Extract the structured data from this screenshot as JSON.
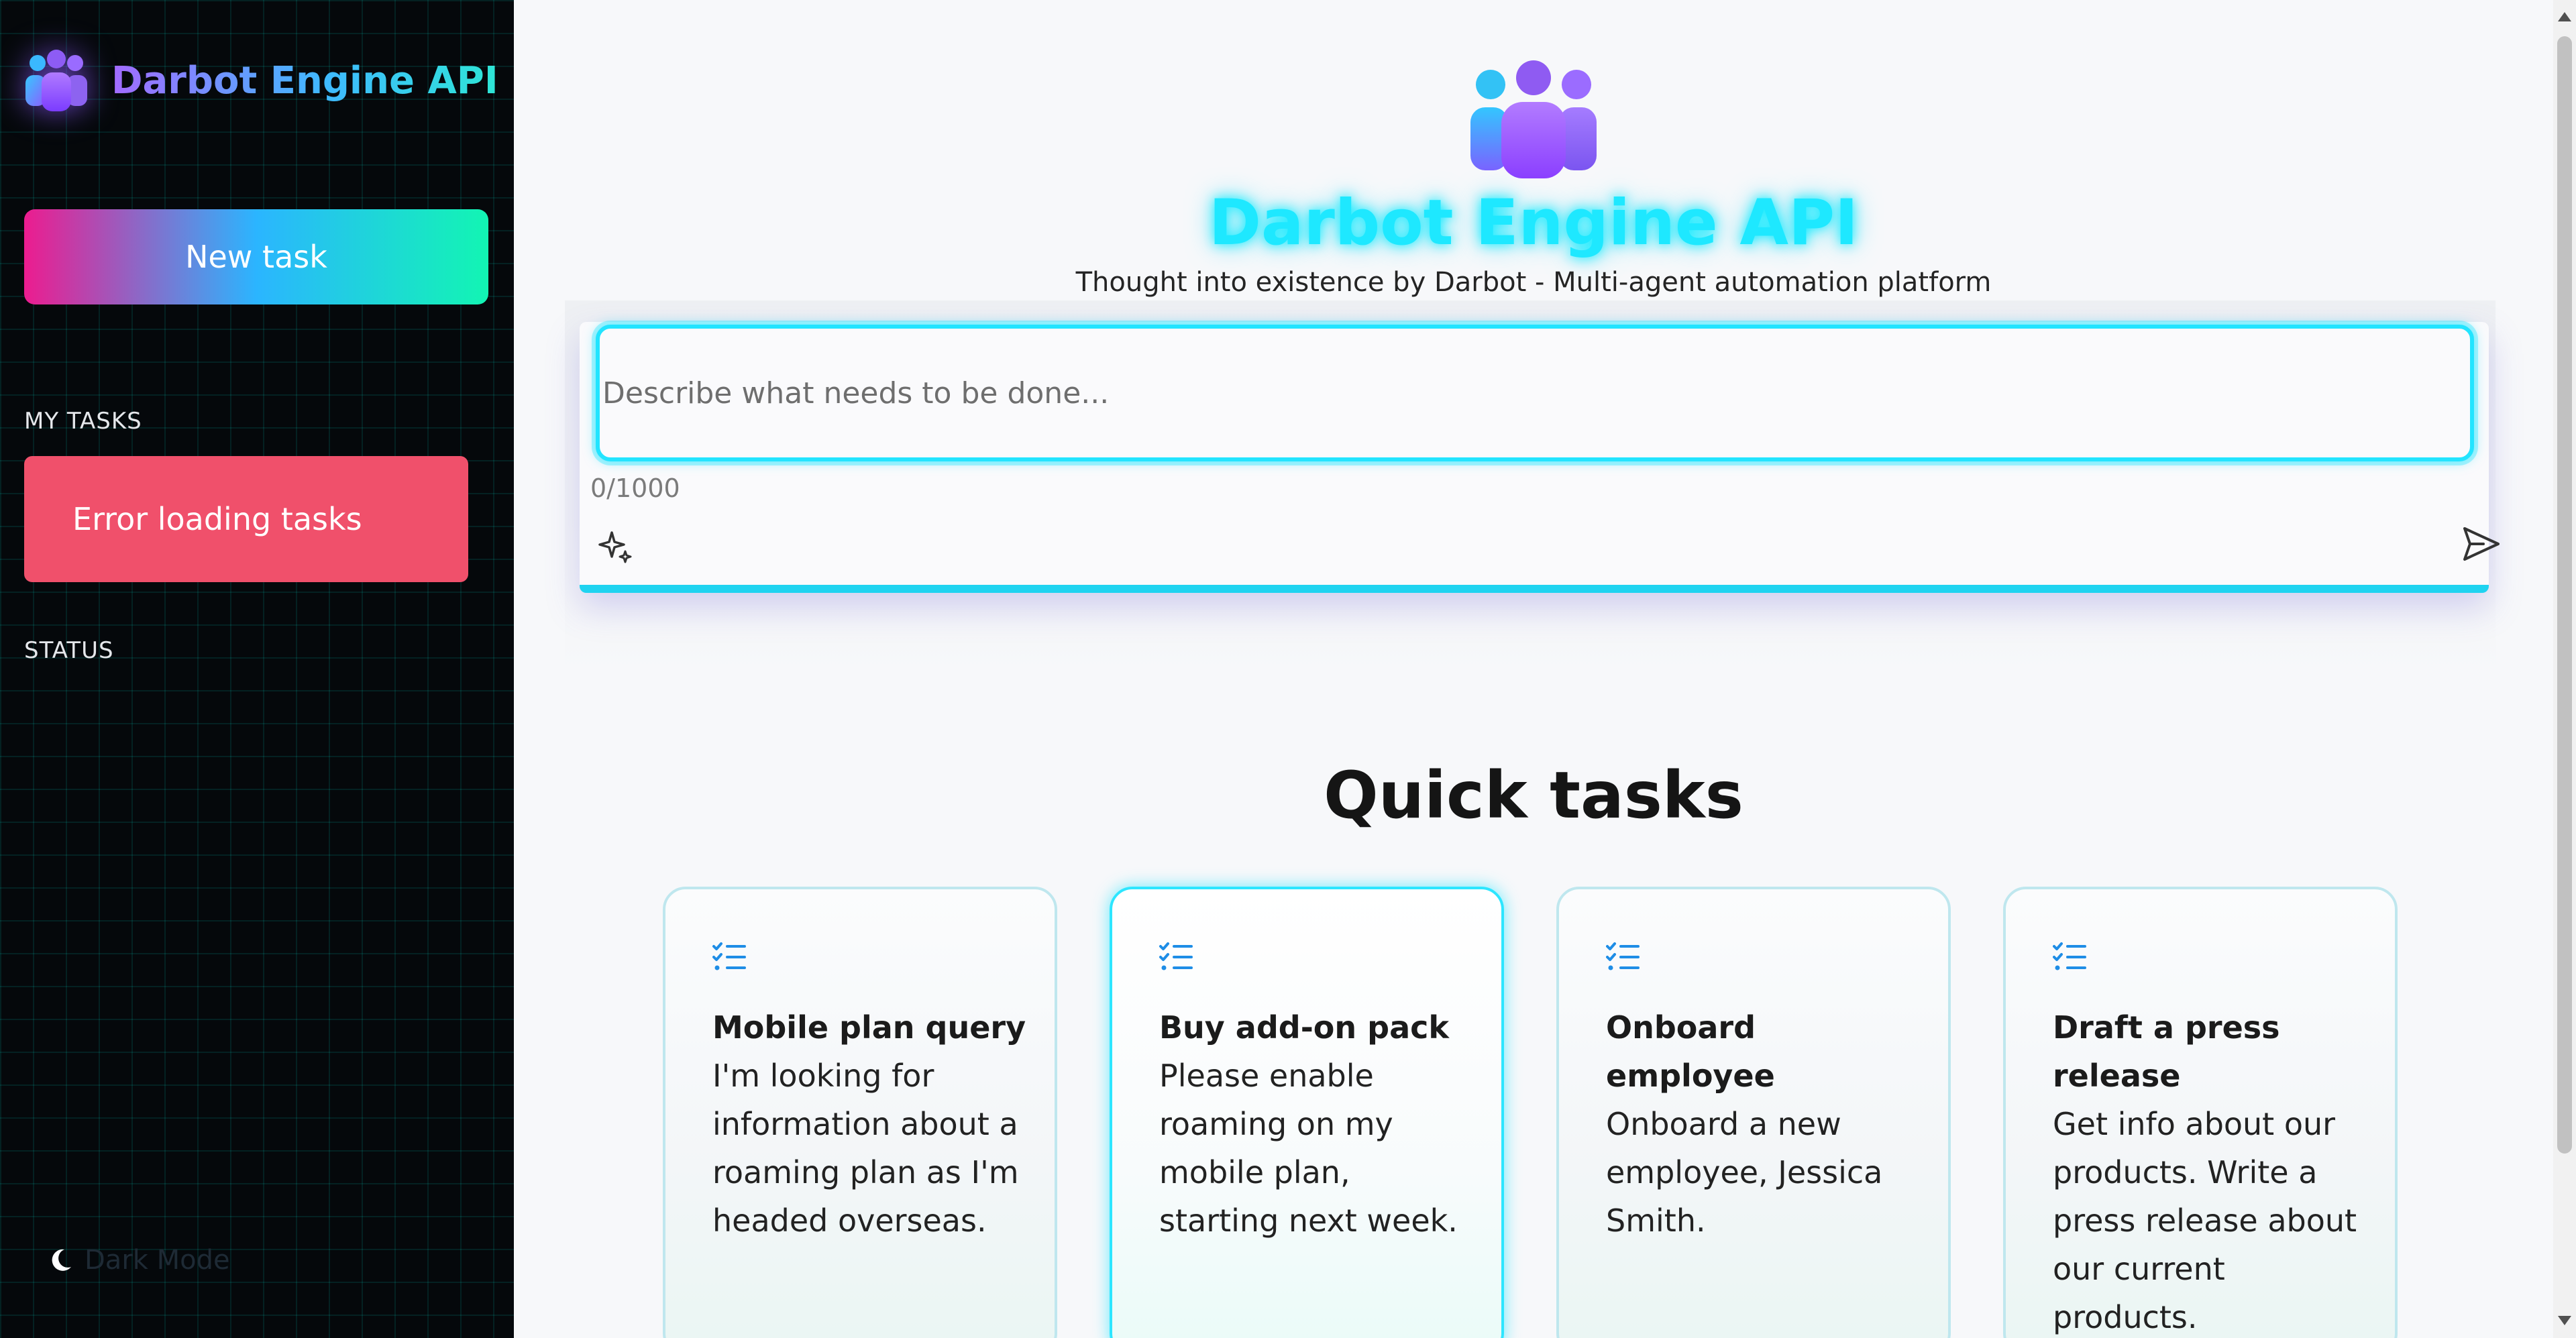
{
  "sidebar": {
    "brand_title": "Darbot Engine API",
    "new_task_label": "New task",
    "my_tasks_label": "MY TASKS",
    "error_message": "Error loading tasks",
    "status_label": "STATUS",
    "dark_mode_label": "Dark Mode"
  },
  "hero": {
    "title": "Darbot Engine API",
    "subtitle": "Thought into existence by Darbot - Multi-agent automation platform"
  },
  "composer": {
    "placeholder": "Describe what needs to be done...",
    "char_count": "0/1000"
  },
  "quick_tasks": {
    "heading": "Quick tasks",
    "cards": [
      {
        "title": "Mobile plan query",
        "description": "I'm looking for information about a roaming plan as I'm headed overseas."
      },
      {
        "title": "Buy add-on pack",
        "description": "Please enable roaming on my mobile plan, starting next week."
      },
      {
        "title": "Onboard employee",
        "description": "Onboard a new employee, Jessica Smith."
      },
      {
        "title": "Draft a press release",
        "description": "Get info about our products. Write a press release about our current products."
      }
    ]
  },
  "colors": {
    "accent_cyan": "#1ee8ff",
    "error_red": "#f0506b",
    "sidebar_bg": "#05080b"
  },
  "icons": {
    "brand": "people-group-icon",
    "sparkle": "sparkle-icon",
    "send": "send-icon",
    "task": "task-list-icon",
    "dark_mode": "moon-icon"
  }
}
